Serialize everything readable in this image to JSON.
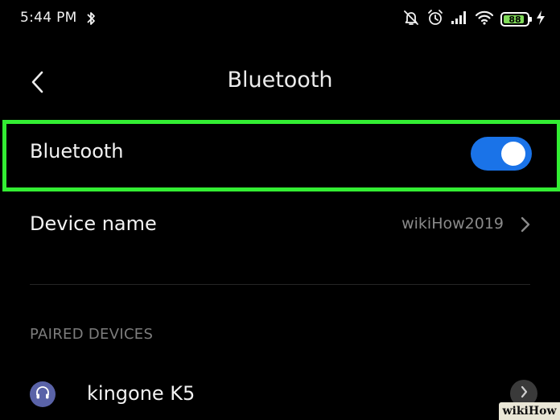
{
  "status_bar": {
    "time": "5:44 PM",
    "battery_level": "88",
    "battery_fraction": 0.88,
    "icons": [
      "bluetooth-icon",
      "mute-bell-icon",
      "alarm-icon",
      "signal-icon",
      "wifi-icon",
      "battery-icon",
      "charging-icon"
    ]
  },
  "header": {
    "back_icon": "chevron-left-icon",
    "title": "Bluetooth"
  },
  "bluetooth_toggle": {
    "label": "Bluetooth",
    "state": "on"
  },
  "device_name": {
    "label": "Device name",
    "value": "wikiHow2019"
  },
  "paired_devices": {
    "header": "PAIRED DEVICES",
    "items": [
      {
        "name": "kingone K5",
        "icon": "headphones-icon"
      }
    ]
  },
  "watermark": {
    "text": "wikiHow"
  },
  "colors": {
    "highlight": "#33ee33",
    "toggle_on": "#1a73e8",
    "battery_fill": "#7ed957",
    "device_avatar": "#5a63a8"
  }
}
